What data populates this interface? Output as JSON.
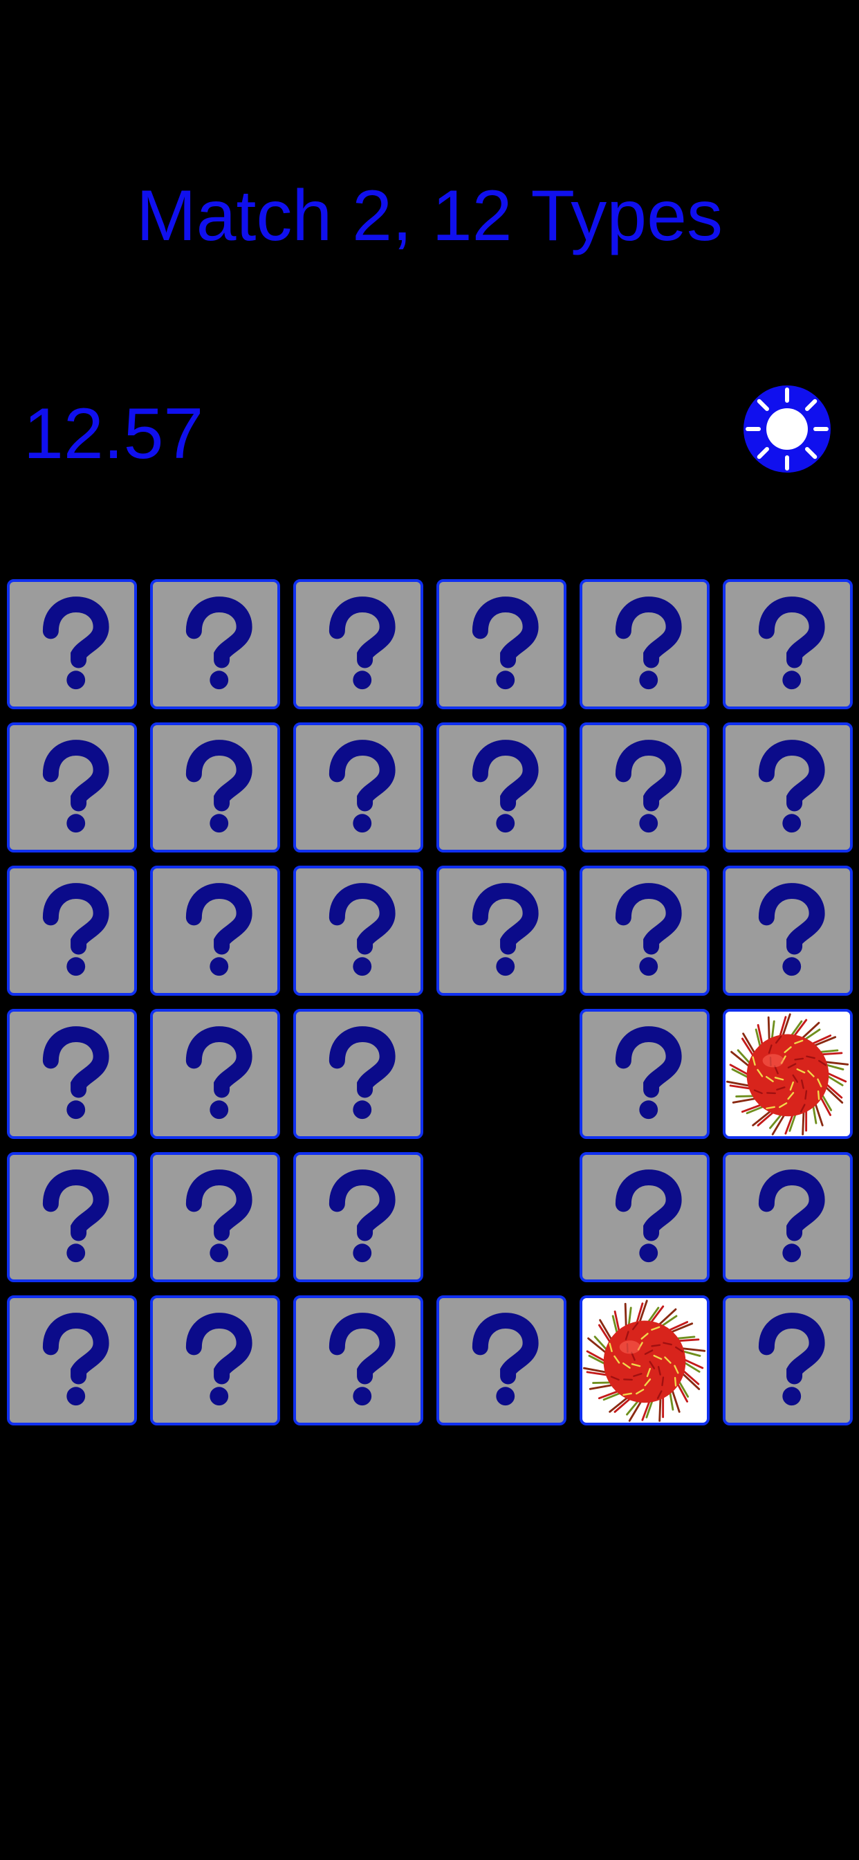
{
  "header": {
    "title": "Match 2, 12 Types",
    "timer": "12.57"
  },
  "settings": {
    "icon": "gear-icon"
  },
  "colors": {
    "accent": "#1010EE",
    "card_border": "#1030F0",
    "card_face": "#9C9C9C",
    "question_mark": "#0B0B8A",
    "revealed_bg": "#FFFFFF",
    "background": "#000000"
  },
  "board": {
    "rows": 6,
    "cols": 6,
    "cards": [
      {
        "state": "hidden"
      },
      {
        "state": "hidden"
      },
      {
        "state": "hidden"
      },
      {
        "state": "hidden"
      },
      {
        "state": "hidden"
      },
      {
        "state": "hidden"
      },
      {
        "state": "hidden"
      },
      {
        "state": "hidden"
      },
      {
        "state": "hidden"
      },
      {
        "state": "hidden"
      },
      {
        "state": "hidden"
      },
      {
        "state": "hidden"
      },
      {
        "state": "hidden"
      },
      {
        "state": "hidden"
      },
      {
        "state": "hidden"
      },
      {
        "state": "hidden"
      },
      {
        "state": "hidden"
      },
      {
        "state": "hidden"
      },
      {
        "state": "hidden"
      },
      {
        "state": "hidden"
      },
      {
        "state": "hidden"
      },
      {
        "state": "matched"
      },
      {
        "state": "hidden"
      },
      {
        "state": "revealed",
        "item": "rambutan-icon"
      },
      {
        "state": "hidden"
      },
      {
        "state": "hidden"
      },
      {
        "state": "hidden"
      },
      {
        "state": "matched"
      },
      {
        "state": "hidden"
      },
      {
        "state": "hidden"
      },
      {
        "state": "hidden"
      },
      {
        "state": "hidden"
      },
      {
        "state": "hidden"
      },
      {
        "state": "hidden"
      },
      {
        "state": "revealed",
        "item": "rambutan-icon"
      },
      {
        "state": "hidden"
      }
    ]
  }
}
